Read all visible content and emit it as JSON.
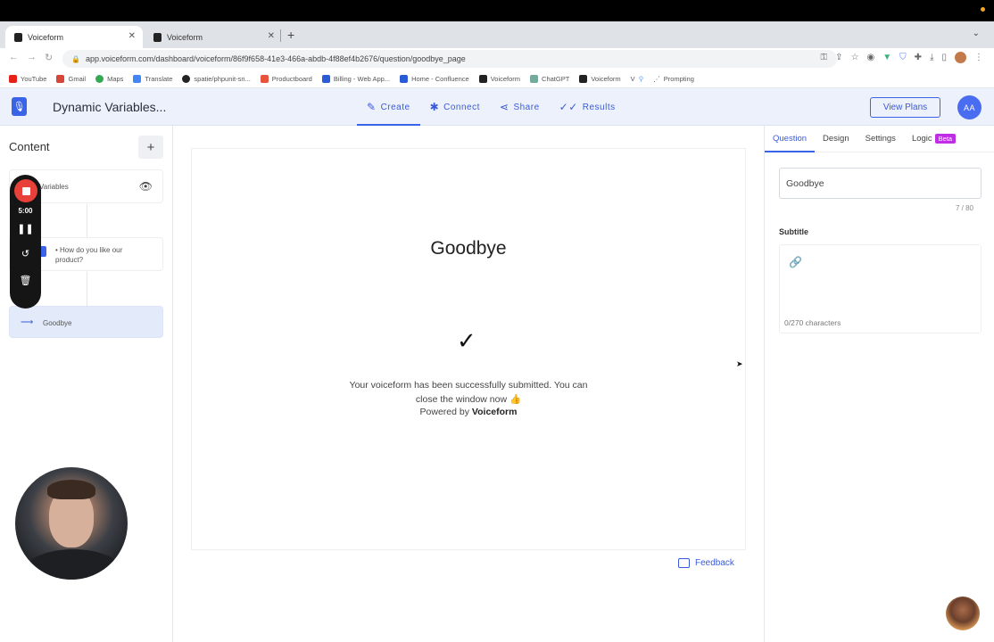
{
  "browser": {
    "tabs": [
      {
        "title": "Voiceform",
        "active": true
      },
      {
        "title": "Voiceform",
        "active": false
      }
    ],
    "url": "app.voiceform.com/dashboard/voiceform/86f9f658-41e3-466a-abdb-4f88ef4b2676/question/goodbye_page",
    "bookmarks": [
      "YouTube",
      "Gmail",
      "Maps",
      "Translate",
      "spatie/phpunit-sn...",
      "Productboard",
      "Billing - Web App...",
      "Home - Confluence",
      "Voiceform",
      "ChatGPT",
      "Voiceform",
      "V",
      "Prompting"
    ]
  },
  "header": {
    "form_title": "Dynamic Variables...",
    "nav": [
      {
        "label": "Create",
        "icon": "pencil-icon"
      },
      {
        "label": "Connect",
        "icon": "puzzle-icon"
      },
      {
        "label": "Share",
        "icon": "share-icon"
      },
      {
        "label": "Results",
        "icon": "results-icon"
      }
    ],
    "view_plans": "View Plans",
    "avatar_initials": "AA"
  },
  "sidebar": {
    "title": "Content",
    "add": "+",
    "items": [
      {
        "label": "Variables"
      },
      {
        "label": "How do you like our product?"
      },
      {
        "label": "Goodbye",
        "selected": true
      }
    ]
  },
  "recorder": {
    "time": "5:00"
  },
  "preview": {
    "heading": "Goodbye",
    "message": "Your voiceform has been successfully submitted. You can close the window now 👍",
    "powered_by": "Powered by",
    "brand": "Voiceform"
  },
  "feedback": "Feedback",
  "right_panel": {
    "tabs": [
      "Question",
      "Design",
      "Settings",
      "Logic"
    ],
    "beta": "Beta",
    "title_value": "Goodbye",
    "title_count": "7 / 80",
    "subtitle_label": "Subtitle",
    "subtitle_count": "0/270 characters"
  },
  "colors": {
    "accent": "#3a63e8",
    "header_bg": "#ecf1fc",
    "beta": "#c02de6",
    "recorder_stop": "#e8413a"
  }
}
